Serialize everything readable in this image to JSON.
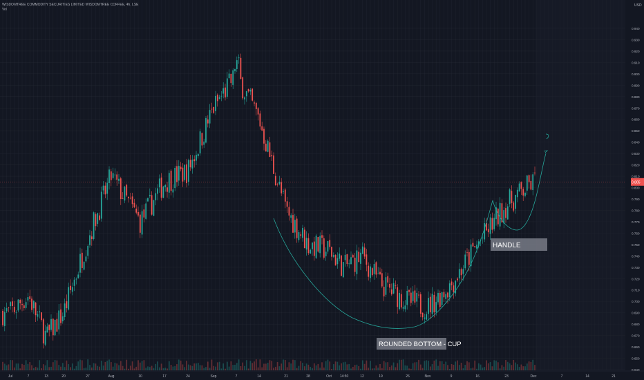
{
  "header": {
    "title": "WISDOMTREE COMMODITY SECURITIES LIMITED WISDOMTREE COFFEE, 4h, LSE",
    "vol_label": "Vol"
  },
  "price_axis": {
    "currency": "USD",
    "ticks": [
      "0.940",
      "0.930",
      "0.920",
      "0.910",
      "0.900",
      "0.890",
      "0.880",
      "0.870",
      "0.860",
      "0.850",
      "0.840",
      "0.830",
      "0.820",
      "0.810",
      "0.800",
      "0.790",
      "0.780",
      "0.770",
      "0.760",
      "0.750",
      "0.740",
      "0.730",
      "0.720",
      "0.710",
      "0.700",
      "0.690",
      "0.680",
      "0.670",
      "0.660",
      "0.650",
      "0.640"
    ],
    "current_price": "0.805"
  },
  "time_axis": {
    "labels": [
      "Jul",
      "7",
      "13",
      "20",
      "27",
      "Aug",
      "10",
      "17",
      "24",
      "Sep",
      "7",
      "14",
      "21",
      "28",
      "Oct",
      "14:50",
      "12",
      "19",
      "26",
      "Nov",
      "9",
      "16",
      "23",
      "Dec",
      "7",
      "14",
      "21"
    ]
  },
  "annotations": {
    "cup_label": "ROUNDED BOTTOM - CUP",
    "handle_label": "HANDLE"
  },
  "colors": {
    "background": "#131722",
    "up": "#26a69a",
    "down": "#ef5350",
    "grid": "#2a2e39",
    "curve": "#26a69a",
    "label_box": "#787b86"
  },
  "chart_data": {
    "type": "candlestick",
    "title": "WISDOMTREE COMMODITY SECURITIES LIMITED WISDOMTREE COFFEE, 4h, LSE",
    "ylim": [
      0.64,
      0.945
    ],
    "anchors": [
      {
        "x": "Jul",
        "close": 0.69
      },
      {
        "x": "7",
        "close": 0.705
      },
      {
        "x": "13",
        "close": 0.668
      },
      {
        "x": "20",
        "close": 0.69
      },
      {
        "x": "27",
        "close": 0.755
      },
      {
        "x": "Aug",
        "close": 0.81
      },
      {
        "x": "10",
        "close": 0.77
      },
      {
        "x": "17",
        "close": 0.805
      },
      {
        "x": "24",
        "close": 0.815
      },
      {
        "x": "Sep",
        "close": 0.87
      },
      {
        "x": "7",
        "close": 0.9
      },
      {
        "x": "14",
        "close": 0.86
      },
      {
        "x": "21",
        "close": 0.78
      },
      {
        "x": "28",
        "close": 0.75
      },
      {
        "x": "Oct",
        "close": 0.745
      },
      {
        "x": "14:50",
        "close": 0.73
      },
      {
        "x": "12",
        "close": 0.74
      },
      {
        "x": "19",
        "close": 0.715
      },
      {
        "x": "26",
        "close": 0.7
      },
      {
        "x": "Nov",
        "close": 0.695
      },
      {
        "x": "9",
        "close": 0.715
      },
      {
        "x": "16",
        "close": 0.75
      },
      {
        "x": "23",
        "close": 0.785
      },
      {
        "x": "Dec",
        "close": 0.805
      }
    ],
    "annotations": [
      "ROUNDED BOTTOM - CUP",
      "HANDLE"
    ]
  }
}
